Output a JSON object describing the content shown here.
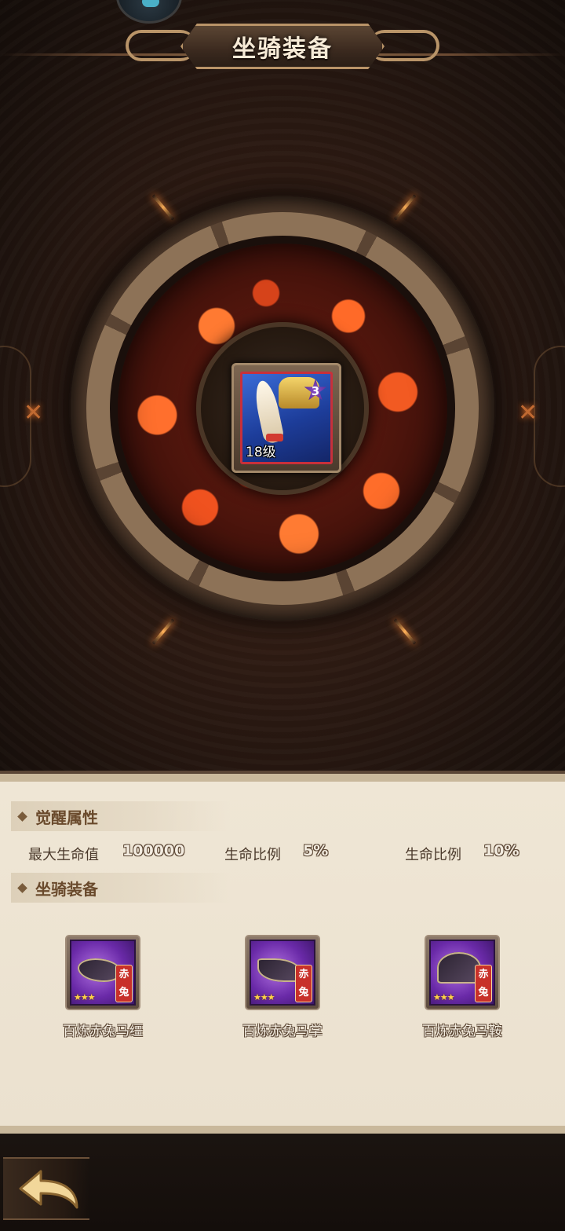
{
  "header": {
    "title": "坐骑装备"
  },
  "mount": {
    "level": "18级",
    "stars": "3"
  },
  "awaken": {
    "title": "觉醒属性",
    "stats": [
      {
        "label": "最大生命值",
        "value": "100000"
      },
      {
        "label": "生命比例",
        "value": "5%"
      },
      {
        "label": "生命比例",
        "value": "10%"
      }
    ]
  },
  "equipment": {
    "title": "坐骑装备",
    "items": [
      {
        "name": "百炼赤兔马缰",
        "tag": "赤兔",
        "stars": "★★★"
      },
      {
        "name": "百炼赤兔马掌",
        "tag": "赤兔",
        "stars": "★★★"
      },
      {
        "name": "百炼赤兔马鞍",
        "tag": "赤兔",
        "stars": "★★★"
      }
    ]
  },
  "colors": {
    "accent": "#c8302a",
    "gold": "#b99468",
    "panel": "#efe6d5"
  },
  "icons": {
    "back": "back-arrow-icon"
  }
}
